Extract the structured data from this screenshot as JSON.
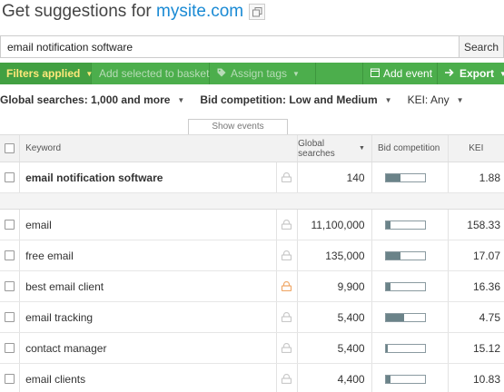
{
  "header": {
    "title_prefix": "Get suggestions for ",
    "site": "mysite.com"
  },
  "search": {
    "value": "email notification software",
    "button": "Search"
  },
  "toolbar": {
    "filters_applied": "Filters applied",
    "add_to_basket": "Add selected to basket",
    "assign_tags": "Assign tags",
    "add_event": "Add event",
    "export": "Export"
  },
  "filters": {
    "global": "Global searches: 1,000 and more",
    "bid": "Bid competition: Low and Medium",
    "kei": "KEI: Any"
  },
  "show_events": "Show events",
  "table": {
    "columns": {
      "keyword": "Keyword",
      "global": "Global searches",
      "bid": "Bid competition",
      "kei": "KEI"
    },
    "main_row": {
      "keyword": "email notification software",
      "global": "140",
      "bid_fraction": 0.38,
      "kei": "1.88",
      "lock_color": "#c9c9c9"
    },
    "rows": [
      {
        "keyword": "email",
        "global": "11,100,000",
        "bid_fraction": 0.12,
        "kei": "158.33",
        "lock_color": "#c9c9c9"
      },
      {
        "keyword": "free email",
        "global": "135,000",
        "bid_fraction": 0.38,
        "kei": "17.07",
        "lock_color": "#c9c9c9"
      },
      {
        "keyword": "best email client",
        "global": "9,900",
        "bid_fraction": 0.12,
        "kei": "16.36",
        "lock_color": "#f0a868"
      },
      {
        "keyword": "email tracking",
        "global": "5,400",
        "bid_fraction": 0.48,
        "kei": "4.75",
        "lock_color": "#c9c9c9"
      },
      {
        "keyword": "contact manager",
        "global": "5,400",
        "bid_fraction": 0.06,
        "kei": "15.12",
        "lock_color": "#c9c9c9"
      },
      {
        "keyword": "email clients",
        "global": "4,400",
        "bid_fraction": 0.12,
        "kei": "10.83",
        "lock_color": "#c9c9c9"
      }
    ]
  }
}
